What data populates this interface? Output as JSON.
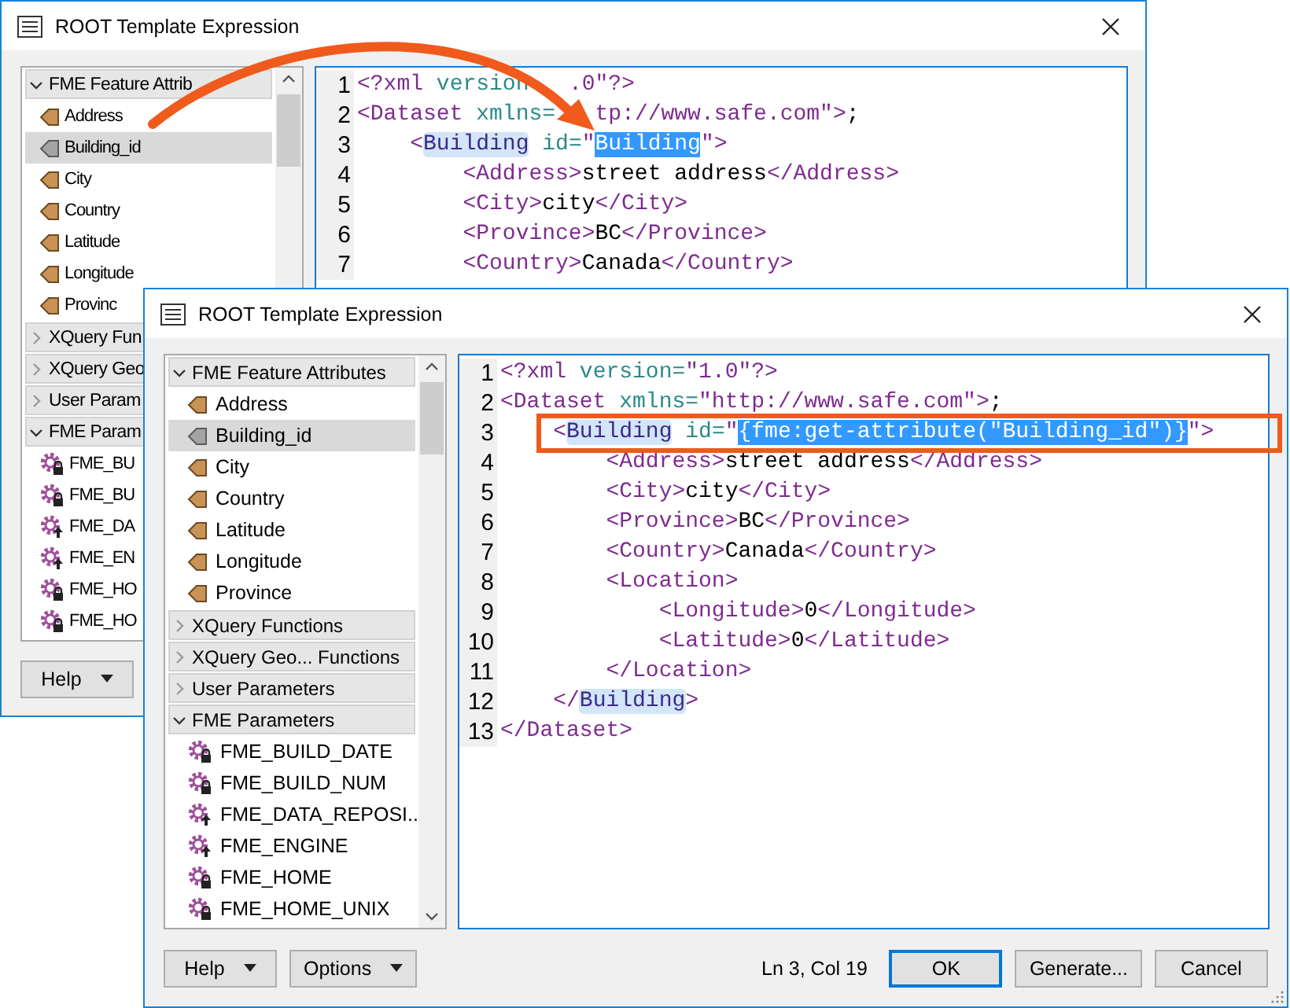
{
  "windows": [
    {
      "title": "ROOT Template Expression",
      "sections": [
        {
          "label": "FME Feature Attrib",
          "expanded": true,
          "items": [
            {
              "label": "Address",
              "kind": "attribute",
              "selected": false
            },
            {
              "label": "Building_id",
              "kind": "attribute",
              "selected": true
            },
            {
              "label": "City",
              "kind": "attribute",
              "selected": false
            },
            {
              "label": "Country",
              "kind": "attribute",
              "selected": false
            },
            {
              "label": "Latitude",
              "kind": "attribute",
              "selected": false
            },
            {
              "label": "Longitude",
              "kind": "attribute",
              "selected": false
            },
            {
              "label": "Provinc",
              "kind": "attribute",
              "selected": false
            }
          ]
        },
        {
          "label": "XQuery Fun",
          "expanded": false
        },
        {
          "label": "XQuery Geo",
          "expanded": false
        },
        {
          "label": "User Param",
          "expanded": false
        },
        {
          "label": "FME Param",
          "expanded": true,
          "items": [
            {
              "label": "FME_BU",
              "kind": "locked",
              "selected": false
            },
            {
              "label": "FME_BU",
              "kind": "locked",
              "selected": false
            },
            {
              "label": "FME_DA",
              "kind": "published",
              "selected": false
            },
            {
              "label": "FME_EN",
              "kind": "published",
              "selected": false
            },
            {
              "label": "FME_HO",
              "kind": "locked",
              "selected": false
            },
            {
              "label": "FME_HO",
              "kind": "locked",
              "selected": false
            }
          ]
        }
      ],
      "code_lines": [
        {
          "number": "1",
          "tokens": [
            {
              "kind": "tag",
              "text": "<?xml"
            },
            {
              "kind": "attr",
              "text": " version"
            },
            {
              "kind": "covered"
            },
            {
              "kind": "tag",
              "text": ".0\"?>"
            }
          ]
        },
        {
          "number": "2",
          "tokens": [
            {
              "kind": "tag",
              "text": "<Dataset"
            },
            {
              "kind": "attr",
              "text": " xmlns="
            },
            {
              "kind": "covered"
            },
            {
              "kind": "tag",
              "text": "tp://www.safe.com\">"
            },
            {
              "kind": "text",
              "text": ";"
            }
          ]
        },
        {
          "number": "3",
          "tokens": [
            {
              "kind": "tag",
              "text": "    <"
            },
            {
              "kind": "match",
              "text": "Building"
            },
            {
              "kind": "attr",
              "text": " id="
            },
            {
              "kind": "tag",
              "text": "\""
            },
            {
              "kind": "selected",
              "text": "Building"
            },
            {
              "kind": "tag",
              "text": "\">"
            }
          ]
        },
        {
          "number": "4",
          "tokens": [
            {
              "kind": "tag",
              "text": "        <Address>"
            },
            {
              "kind": "text",
              "text": "street address"
            },
            {
              "kind": "tag",
              "text": "</Address>"
            }
          ]
        },
        {
          "number": "5",
          "tokens": [
            {
              "kind": "tag",
              "text": "        <City>"
            },
            {
              "kind": "text",
              "text": "city"
            },
            {
              "kind": "tag",
              "text": "</City>"
            }
          ]
        },
        {
          "number": "6",
          "tokens": [
            {
              "kind": "tag",
              "text": "        <Province>"
            },
            {
              "kind": "text",
              "text": "BC"
            },
            {
              "kind": "tag",
              "text": "</Province>"
            }
          ]
        },
        {
          "number": "7",
          "tokens": [
            {
              "kind": "tag",
              "text": "        <Country>"
            },
            {
              "kind": "text",
              "text": "Canada"
            },
            {
              "kind": "tag",
              "text": "</Country>"
            }
          ]
        }
      ],
      "buttons": [
        {
          "label": "Help",
          "kind": "dropdown",
          "default": false
        }
      ]
    },
    {
      "title": "ROOT Template Expression",
      "sections": [
        {
          "label": "FME Feature Attributes",
          "expanded": true,
          "items": [
            {
              "label": "Address",
              "kind": "attribute",
              "selected": false
            },
            {
              "label": "Building_id",
              "kind": "attribute",
              "selected": true
            },
            {
              "label": "City",
              "kind": "attribute",
              "selected": false
            },
            {
              "label": "Country",
              "kind": "attribute",
              "selected": false
            },
            {
              "label": "Latitude",
              "kind": "attribute",
              "selected": false
            },
            {
              "label": "Longitude",
              "kind": "attribute",
              "selected": false
            },
            {
              "label": "Province",
              "kind": "attribute",
              "selected": false
            }
          ]
        },
        {
          "label": "XQuery Functions",
          "expanded": false
        },
        {
          "label": "XQuery Geo... Functions",
          "expanded": false
        },
        {
          "label": "User Parameters",
          "expanded": false
        },
        {
          "label": "FME Parameters",
          "expanded": true,
          "items": [
            {
              "label": "FME_BUILD_DATE",
              "kind": "locked",
              "selected": false
            },
            {
              "label": "FME_BUILD_NUM",
              "kind": "locked",
              "selected": false
            },
            {
              "label": "FME_DATA_REPOSI...",
              "kind": "published",
              "selected": false
            },
            {
              "label": "FME_ENGINE",
              "kind": "published",
              "selected": false
            },
            {
              "label": "FME_HOME",
              "kind": "locked",
              "selected": false
            },
            {
              "label": "FME_HOME_UNIX",
              "kind": "locked",
              "selected": false
            }
          ]
        }
      ],
      "code_lines": [
        {
          "number": "1",
          "tokens": [
            {
              "kind": "tag",
              "text": "<?xml"
            },
            {
              "kind": "attr",
              "text": " version="
            },
            {
              "kind": "tag",
              "text": "\"1.0\"?>"
            }
          ]
        },
        {
          "number": "2",
          "tokens": [
            {
              "kind": "tag",
              "text": "<Dataset"
            },
            {
              "kind": "attr",
              "text": " xmlns="
            },
            {
              "kind": "tag",
              "text": "\"http://www.safe.com\">"
            },
            {
              "kind": "text",
              "text": ";"
            }
          ]
        },
        {
          "number": "3",
          "tokens": [
            {
              "kind": "tag",
              "text": "    <"
            },
            {
              "kind": "match",
              "text": "Building"
            },
            {
              "kind": "attr",
              "text": " id="
            },
            {
              "kind": "tag",
              "text": "\""
            },
            {
              "kind": "selected",
              "text": "{fme:get-attribute(\"Building_id\")}"
            },
            {
              "kind": "tag",
              "text": "\">"
            }
          ]
        },
        {
          "number": "4",
          "tokens": [
            {
              "kind": "tag",
              "text": "        <Address>"
            },
            {
              "kind": "text",
              "text": "street address"
            },
            {
              "kind": "tag",
              "text": "</Address>"
            }
          ]
        },
        {
          "number": "5",
          "tokens": [
            {
              "kind": "tag",
              "text": "        <City>"
            },
            {
              "kind": "text",
              "text": "city"
            },
            {
              "kind": "tag",
              "text": "</City>"
            }
          ]
        },
        {
          "number": "6",
          "tokens": [
            {
              "kind": "tag",
              "text": "        <Province>"
            },
            {
              "kind": "text",
              "text": "BC"
            },
            {
              "kind": "tag",
              "text": "</Province>"
            }
          ]
        },
        {
          "number": "7",
          "tokens": [
            {
              "kind": "tag",
              "text": "        <Country>"
            },
            {
              "kind": "text",
              "text": "Canada"
            },
            {
              "kind": "tag",
              "text": "</Country>"
            }
          ]
        },
        {
          "number": "8",
          "tokens": [
            {
              "kind": "tag",
              "text": "        <Location>"
            }
          ]
        },
        {
          "number": "9",
          "tokens": [
            {
              "kind": "tag",
              "text": "            <Longitude>"
            },
            {
              "kind": "text",
              "text": "0"
            },
            {
              "kind": "tag",
              "text": "</Longitude>"
            }
          ]
        },
        {
          "number": "10",
          "tokens": [
            {
              "kind": "tag",
              "text": "            <Latitude>"
            },
            {
              "kind": "text",
              "text": "0"
            },
            {
              "kind": "tag",
              "text": "</Latitude>"
            }
          ]
        },
        {
          "number": "11",
          "tokens": [
            {
              "kind": "tag",
              "text": "        </Location>"
            }
          ]
        },
        {
          "number": "12",
          "tokens": [
            {
              "kind": "tag",
              "text": "    </"
            },
            {
              "kind": "match",
              "text": "Building"
            },
            {
              "kind": "tag",
              "text": ">"
            }
          ]
        },
        {
          "number": "13",
          "tokens": [
            {
              "kind": "tag",
              "text": "</Dataset>"
            }
          ]
        }
      ],
      "status": "Ln 3, Col 19",
      "buttons": [
        {
          "label": "Help",
          "kind": "dropdown",
          "default": false
        },
        {
          "label": "Options",
          "kind": "dropdown",
          "default": false
        },
        {
          "label": "OK",
          "kind": "push",
          "default": true
        },
        {
          "label": "Generate...",
          "kind": "push",
          "default": false
        },
        {
          "label": "Cancel",
          "kind": "push",
          "default": false
        }
      ]
    }
  ]
}
